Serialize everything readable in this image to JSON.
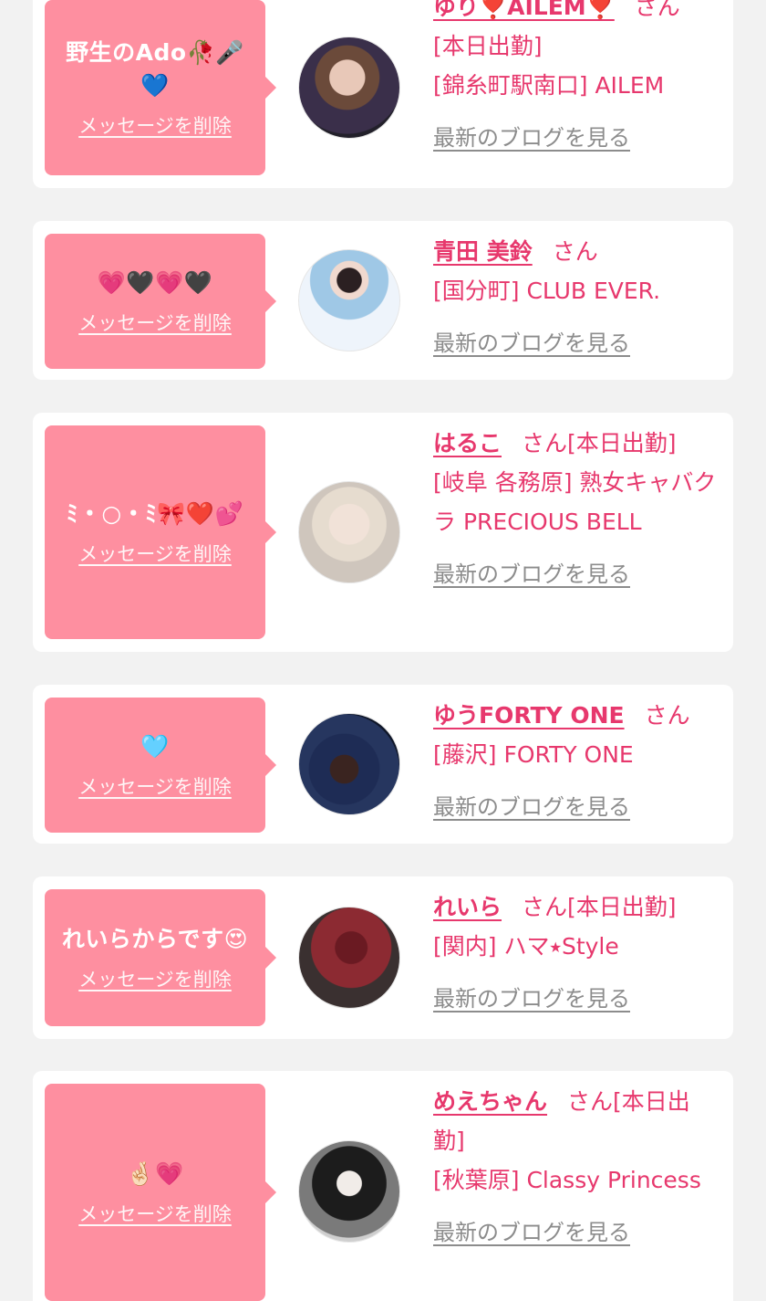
{
  "delete_label": "メッセージを削除",
  "blog_label": "最新のブログを見る",
  "honorific": "さん",
  "cards": [
    {
      "message": "野生のAdo🥀🎤💙",
      "name": "ゆり❣️AILEM❣️",
      "work": "",
      "location": "[本日出勤]",
      "location2": "[錦糸町駅南口] AILEM"
    },
    {
      "message": "💗🖤💗🖤",
      "name": "青田 美鈴",
      "work": "",
      "location": "[国分町] CLUB EVER.",
      "location2": ""
    },
    {
      "message": "ﾐ・○・ﾐ🎀❤️💕",
      "name": "はるこ",
      "work": "[本日出勤]",
      "location": "[岐阜 各務原]  熟女キャバクラ PRECIOUS BELL",
      "location2": ""
    },
    {
      "message": "🩵",
      "name": "ゆうFORTY ONE",
      "work": "",
      "location": "[藤沢] FORTY ONE",
      "location2": ""
    },
    {
      "message": "れいらからです😍",
      "name": "れいら",
      "work": "[本日出勤]",
      "location": "[関内] ハマ⭑Style",
      "location2": ""
    },
    {
      "message": "🤞🏻💗",
      "name": "めえちゃん",
      "work": "[本日出勤]",
      "location": "[秋葉原] Classy Princess",
      "location2": ""
    }
  ],
  "colors": {
    "accent": "#e7386d",
    "bubble": "#fe8fa0",
    "background": "#f2f2f2",
    "blog_link": "#8c8c8c"
  }
}
